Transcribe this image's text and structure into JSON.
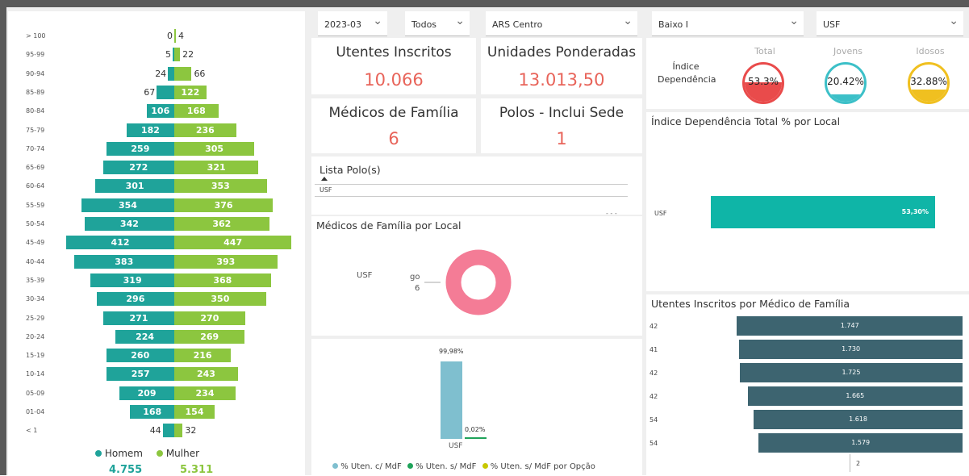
{
  "pyramid": {
    "rows": [
      {
        "age": "> 100",
        "homem": 0,
        "mulher": 4
      },
      {
        "age": "95-99",
        "homem": 5,
        "mulher": 22
      },
      {
        "age": "90-94",
        "homem": 24,
        "mulher": 66
      },
      {
        "age": "85-89",
        "homem": 67,
        "mulher": 122
      },
      {
        "age": "80-84",
        "homem": 106,
        "mulher": 168
      },
      {
        "age": "75-79",
        "homem": 182,
        "mulher": 236
      },
      {
        "age": "70-74",
        "homem": 259,
        "mulher": 305
      },
      {
        "age": "65-69",
        "homem": 272,
        "mulher": 321
      },
      {
        "age": "60-64",
        "homem": 301,
        "mulher": 353
      },
      {
        "age": "55-59",
        "homem": 354,
        "mulher": 376
      },
      {
        "age": "50-54",
        "homem": 342,
        "mulher": 362
      },
      {
        "age": "45-49",
        "homem": 412,
        "mulher": 447
      },
      {
        "age": "40-44",
        "homem": 383,
        "mulher": 393
      },
      {
        "age": "35-39",
        "homem": 319,
        "mulher": 368
      },
      {
        "age": "30-34",
        "homem": 296,
        "mulher": 350
      },
      {
        "age": "25-29",
        "homem": 271,
        "mulher": 270
      },
      {
        "age": "20-24",
        "homem": 224,
        "mulher": 269
      },
      {
        "age": "15-19",
        "homem": 260,
        "mulher": 216
      },
      {
        "age": "10-14",
        "homem": 257,
        "mulher": 243
      },
      {
        "age": "05-09",
        "homem": 209,
        "mulher": 234
      },
      {
        "age": "01-04",
        "homem": 168,
        "mulher": 154
      },
      {
        "age": "< 1",
        "homem": 44,
        "mulher": 32
      }
    ],
    "legend_homem": "Homem",
    "legend_mulher": "Mulher",
    "total_homem": "4.755",
    "total_mulher": "5.311",
    "color_homem": "#1fa39a",
    "color_mulher": "#8cc63f"
  },
  "filters": {
    "periodo": "2023-03",
    "tipo": "Todos",
    "ars": "ARS Centro",
    "aces": "Baixo I",
    "unidade": "USF"
  },
  "kpis": {
    "utentes_title": "Utentes Inscritos",
    "utentes_value": "10.066",
    "unidades_title": "Unidades Ponderadas",
    "unidades_value": "13.013,50",
    "medicos_title": "Médicos de Família",
    "medicos_value": "6",
    "polos_title": "Polos - Inclui Sede",
    "polos_value": "1"
  },
  "lista_polos": {
    "title": "Lista Polo(s)",
    "item": "USF"
  },
  "medicos_local": {
    "title": "Médicos de Família por Local",
    "label": "USF",
    "sublabel": "go",
    "value": "6"
  },
  "cobertura": {
    "bar1_label": "99,98%",
    "bar2_label": "0,02%",
    "x_label": "USF",
    "legend1": "% Uten. c/ MdF",
    "legend2": "% Uten. s/ MdF",
    "legend3": "% Uten. s/ MdF por Opção",
    "c1": "#7fbfcf",
    "c2": "#1fa35a",
    "c3": "#c8c800"
  },
  "dependencia": {
    "label": "Índice Dependência",
    "total_title": "Total",
    "total_value": "53.3%",
    "jovens_title": "Jovens",
    "jovens_value": "20.42%",
    "idosos_title": "Idosos",
    "idosos_value": "32.88%"
  },
  "dep_local": {
    "title": "Índice Dependência Total % por Local",
    "label": "USF",
    "value": "53,30%"
  },
  "utentes_medico": {
    "title": "Utentes Inscritos por Médico de Família",
    "values": [
      "1.747",
      "1.730",
      "1.725",
      "1.665",
      "1.618",
      "1.579"
    ],
    "row_labels": [
      "42",
      "41",
      "42",
      "42",
      "54",
      "54"
    ],
    "extra_label": "2"
  }
}
